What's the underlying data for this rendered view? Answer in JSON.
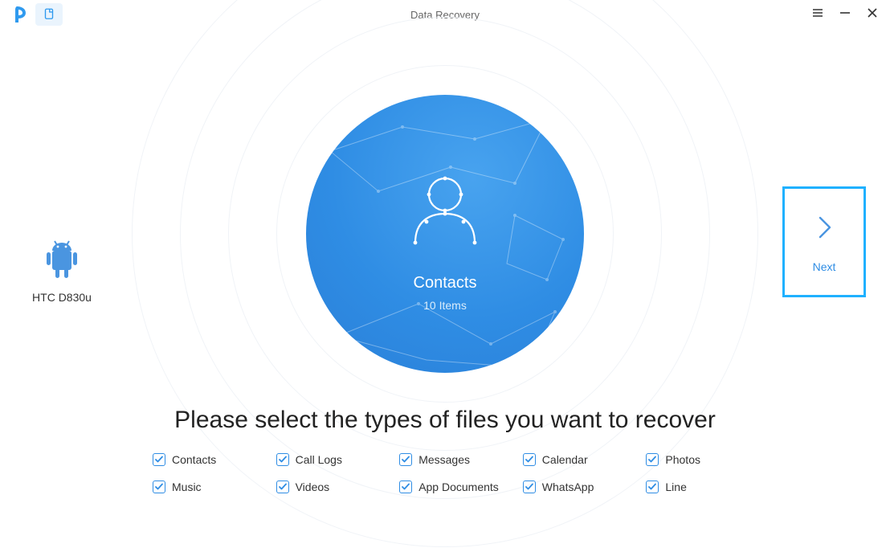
{
  "window": {
    "title": "Data Recovery"
  },
  "device": {
    "name": "HTC D830u"
  },
  "preview": {
    "title": "Contacts",
    "subtitle": "10 Items"
  },
  "next": {
    "label": "Next"
  },
  "instruction": "Please select the types of files you want to recover",
  "types": {
    "items": [
      {
        "label": "Contacts"
      },
      {
        "label": "Call Logs"
      },
      {
        "label": "Messages"
      },
      {
        "label": "Calendar"
      },
      {
        "label": "Photos"
      },
      {
        "label": "Music"
      },
      {
        "label": "Videos"
      },
      {
        "label": "App Documents"
      },
      {
        "label": "WhatsApp"
      },
      {
        "label": "Line"
      }
    ]
  }
}
